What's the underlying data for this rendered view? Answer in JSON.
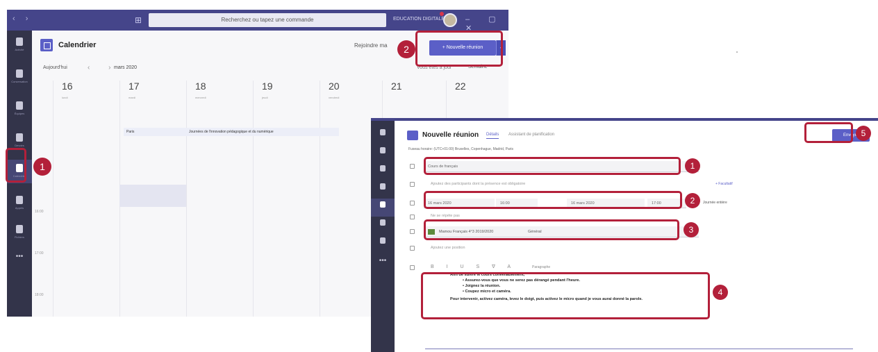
{
  "calendar_window": {
    "title_bar": {
      "nav": "‹ ›",
      "search_placeholder": "Recherchez ou tapez une commande",
      "org_name": "EDUCATION DIGITALE",
      "window_controls": "– ▢ ✕"
    },
    "app_rail": [
      {
        "label": "Activité",
        "icon": "bell-icon"
      },
      {
        "label": "Conversation",
        "icon": "chat-icon"
      },
      {
        "label": "Équipes",
        "icon": "teams-icon"
      },
      {
        "label": "Devoirs",
        "icon": "assignments-icon"
      },
      {
        "label": "Calendrier",
        "icon": "calendar-icon",
        "active": true
      },
      {
        "label": "Appels",
        "icon": "phone-icon"
      },
      {
        "label": "Fichiers",
        "icon": "files-icon"
      }
    ],
    "rail_more": "•••",
    "page_title": "Calendrier",
    "join_now": "Rejoindre ma",
    "new_meeting_button": "+ Nouvelle réunion",
    "new_meeting_caret": "⌄",
    "today_button": "Aujourd'hui",
    "nav_arrows": "‹ ›",
    "month": "mars 2020",
    "week_info": "Vous êtes à jour",
    "view_select": "Semaine",
    "days": [
      {
        "num": "16",
        "name": "lundi"
      },
      {
        "num": "17",
        "name": "mardi"
      },
      {
        "num": "18",
        "name": "mercredi"
      },
      {
        "num": "19",
        "name": "jeudi"
      },
      {
        "num": "20",
        "name": "vendredi"
      },
      {
        "num": "21",
        "name": ""
      },
      {
        "num": "22",
        "name": ""
      }
    ],
    "events": {
      "paris": "Paris",
      "journees": "Journées de l'innovation pédagogique et du numérique"
    },
    "hours": [
      "16:00",
      "17:00",
      "18:00"
    ]
  },
  "meeting_window": {
    "title": "Nouvelle réunion",
    "tabs": [
      "Détails",
      "Assistant de planification"
    ],
    "timezone": "Fuseau horaire: (UTC+01:00) Bruxelles, Copenhague, Madrid, Paris",
    "send_button": "Envoyer",
    "title_field": "Cours de français",
    "attendees_placeholder": "Ajoutez des participants dont la présence est obligatoire",
    "optional_link": "+ Facultatif",
    "start_date": "16 mars 2020",
    "start_time": "16:00",
    "end_date": "16 mars 2020",
    "end_time": "17:00",
    "allday_label": "Journée entière",
    "repeat": "Ne se répète pas",
    "channel_name": "Mamou Français 4°3 2019/2020",
    "channel_sub": "Général",
    "location_placeholder": "Ajoutez une position",
    "toolbar_para": "Paragraphe",
    "description": {
      "intro": "Afin de suivre le cours convenablement,",
      "bullets": [
        "Assurez-vous que vous ne serez pas dérangé pendant l'heure.",
        "Joignez la réunion.",
        "Coupez micro et caméra."
      ],
      "outro": "Pour intervenir, activez caméra, levez le doigt, puis activez le micro quand je vous aurai donné la parole."
    }
  },
  "callouts": [
    "1",
    "2",
    "1",
    "2",
    "3",
    "4",
    "5"
  ],
  "colors": {
    "accent": "#5b5fc7",
    "highlight": "#b3203a",
    "rail": "#33344a",
    "title_bar": "#45458a"
  }
}
